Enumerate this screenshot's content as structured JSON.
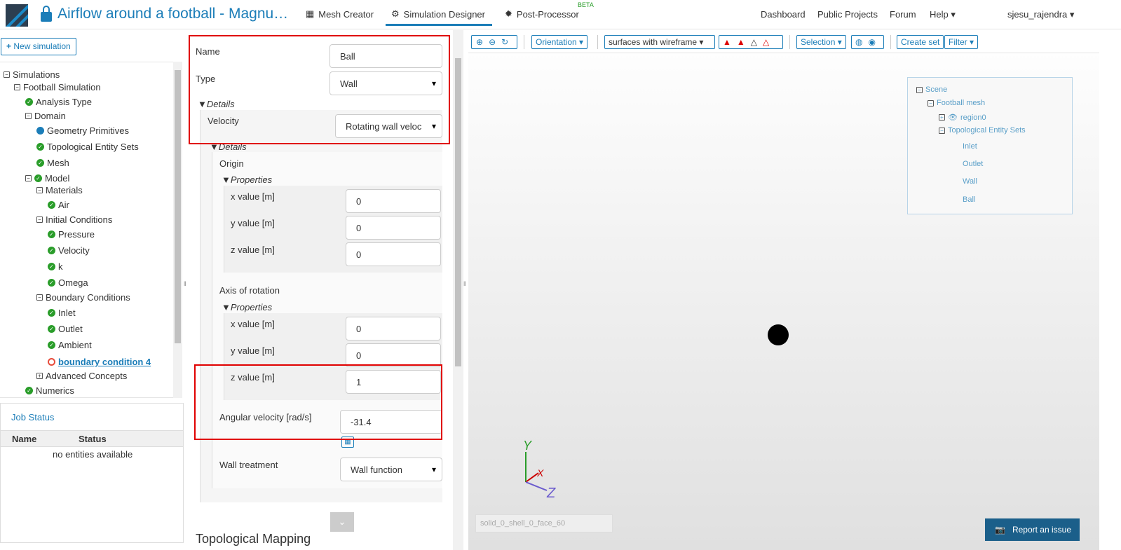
{
  "header": {
    "title": "Airflow around a football - Magnu…",
    "nav": [
      "Mesh Creator",
      "Simulation Designer",
      "Post-Processor"
    ],
    "beta": "BETA",
    "right": [
      "Dashboard",
      "Public Projects",
      "Forum",
      "Help"
    ],
    "user": "sjesu_rajendra"
  },
  "left": {
    "new_sim": "New simulation",
    "tree": [
      "Simulations",
      "Football Simulation",
      "Analysis Type",
      "Domain",
      "Geometry Primitives",
      "Topological Entity Sets",
      "Mesh",
      "Model",
      "Materials",
      "Air",
      "Initial Conditions",
      "Pressure",
      "Velocity",
      "k",
      "Omega",
      "Boundary Conditions",
      "Inlet",
      "Outlet",
      "Ambient",
      "boundary condition 4",
      "Advanced Concepts",
      "Numerics"
    ],
    "job_title": "Job Status",
    "job_cols": [
      "Name",
      "Status"
    ],
    "job_empty": "no entities available"
  },
  "form": {
    "name_label": "Name",
    "name_value": "Ball",
    "type_label": "Type",
    "type_value": "Wall",
    "details": "Details",
    "velocity_label": "Velocity",
    "velocity_value": "Rotating wall veloc",
    "details2": "Details",
    "origin": "Origin",
    "properties": "Properties",
    "x_label": "x value [m]",
    "y_label": "y value [m]",
    "z_label": "z value [m]",
    "origin_x": "0",
    "origin_y": "0",
    "origin_z": "0",
    "axis": "Axis of rotation",
    "axis_x": "0",
    "axis_y": "0",
    "axis_z": "1",
    "ang_label": "Angular velocity [rad/s]",
    "ang_value": "-31.4",
    "wall_label": "Wall treatment",
    "wall_value": "Wall function",
    "topo": "Topological Mapping"
  },
  "viewer": {
    "orientation": "Orientation",
    "render_mode": "surfaces with wireframe",
    "selection": "Selection",
    "create_set": "Create set",
    "filter": "Filter",
    "scene": [
      "Scene",
      "Football mesh",
      "region0",
      "Topological Entity Sets",
      "Inlet",
      "Outlet",
      "Wall",
      "Ball"
    ],
    "axes": [
      "Y",
      "X",
      "Z"
    ],
    "face_field": "solid_0_shell_0_face_60",
    "report": "Report an issue"
  }
}
